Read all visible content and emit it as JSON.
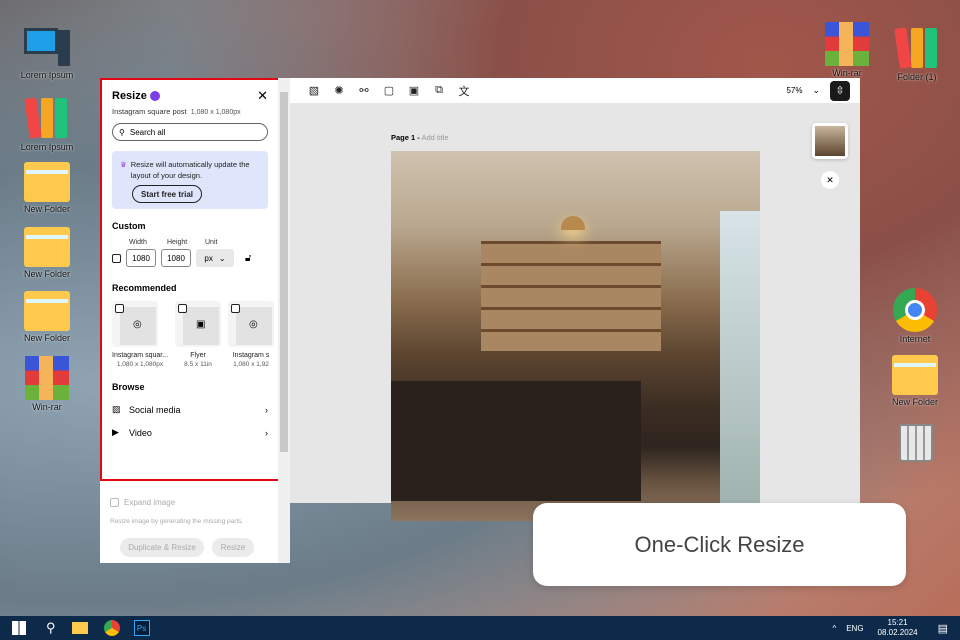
{
  "desktop": {
    "left": [
      {
        "label": "Lorem Ipsum",
        "icon": "computer-icon"
      },
      {
        "label": "Lorem Ipsum",
        "icon": "binders-icon"
      },
      {
        "label": "New Folder",
        "icon": "folder-icon"
      },
      {
        "label": "New Folder",
        "icon": "folder-icon"
      },
      {
        "label": "New Folder",
        "icon": "folder-icon"
      },
      {
        "label": "Win-rar",
        "icon": "winrar-icon"
      }
    ],
    "right": [
      {
        "label": "Win-rar",
        "icon": "winrar-icon"
      },
      {
        "label": "Folder (1)",
        "icon": "binders-icon"
      },
      {
        "label": "Internet",
        "icon": "chrome-icon"
      },
      {
        "label": "New Folder",
        "icon": "folder-icon"
      }
    ]
  },
  "panel": {
    "title": "Resize",
    "subtitle": "Instagram square post",
    "subtitle_size": "1,080 x 1,080px",
    "search_placeholder": "Search all",
    "promo_text": "Resize will automatically update the layout of your design.",
    "promo_button": "Start free trial",
    "custom_heading": "Custom",
    "width_label": "Width",
    "height_label": "Height",
    "unit_label": "Unit",
    "width_value": "1080",
    "height_value": "1080",
    "unit_value": "px",
    "recommended_heading": "Recommended",
    "recommended": [
      {
        "name": "Instagram squar...",
        "size": "1,080 x 1,080px",
        "icon": "instagram-icon"
      },
      {
        "name": "Flyer",
        "size": "8.5 x 11in",
        "icon": "flyer-icon"
      },
      {
        "name": "Instagram s",
        "size": "1,080 x 1,92",
        "icon": "instagram-icon"
      }
    ],
    "browse_heading": "Browse",
    "browse": [
      {
        "label": "Social media",
        "icon": "image-icon"
      },
      {
        "label": "Video",
        "icon": "video-icon"
      }
    ],
    "expand_label": "Expand image",
    "expand_hint": "Resize image by generating the missing parts.",
    "duplicate_button": "Duplicate & Resize",
    "resize_button": "Resize"
  },
  "toolbar": {
    "zoom": "57%"
  },
  "canvas": {
    "page_label": "Page 1 -",
    "page_title_placeholder": "Add title"
  },
  "callout": "One-Click Resize",
  "taskbar": {
    "lang": "ENG",
    "time": "15:21",
    "date": "08.02.2024"
  },
  "colors": {
    "accent_red": "#e30613",
    "taskbar": "#0e2a4b",
    "promo_bg": "#dfe6fb"
  }
}
